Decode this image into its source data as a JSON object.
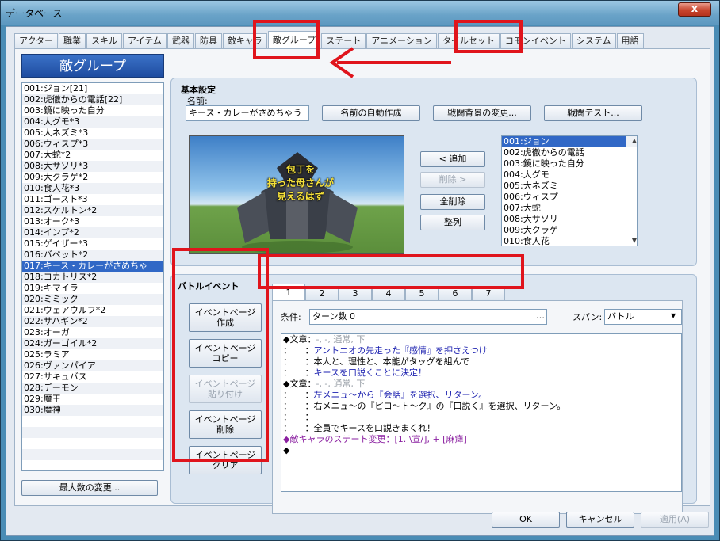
{
  "window": {
    "title": "データベース",
    "close_label": "x"
  },
  "tabs": [
    "アクター",
    "職業",
    "スキル",
    "アイテム",
    "武器",
    "防具",
    "敵キャラ",
    "敵グループ",
    "ステート",
    "アニメーション",
    "タイルセット",
    "コモンイベント",
    "システム",
    "用語"
  ],
  "active_tab_index": 7,
  "list_title": "敵グループ",
  "enemy_groups": [
    "001:ジョン[21]",
    "002:虎徹からの電話[22]",
    "003:鏡に映った自分",
    "004:大グモ*3",
    "005:大ネズミ*3",
    "006:ウィスプ*3",
    "007:大蛇*2",
    "008:大サソリ*3",
    "009:大クラゲ*2",
    "010:食人花*3",
    "011:ゴースト*3",
    "012:スケルトン*2",
    "013:オーク*3",
    "014:インプ*2",
    "015:ゲイザー*3",
    "016:バペット*2",
    "017:キース・カレーがさめちゃ",
    "018:コカトリス*2",
    "019:キマイラ",
    "020:ミミック",
    "021:ウェアウルフ*2",
    "022:サハギン*2",
    "023:オーガ",
    "024:ガーゴイル*2",
    "025:ラミア",
    "026:ヴァンパイア",
    "027:サキュバス",
    "028:デーモン",
    "029:魔王",
    "030:魔神"
  ],
  "selected_group_index": 16,
  "max_button": "最大数の変更...",
  "basic": {
    "section_label": "基本設定",
    "name_label": "名前:",
    "name_value": "キース・カレーがさめちゃう",
    "auto_name_button": "名前の自動作成",
    "change_bg_button": "戦闘背景の変更...",
    "battle_test_button": "戦闘テスト...",
    "preview_caption": "包丁を\n持った母さんが\n見えるはず",
    "add_button": "< 追加",
    "remove_button": "削除 >",
    "clear_button": "全削除",
    "align_button": "整列"
  },
  "members": [
    "001:ジョン",
    "002:虎徹からの電話",
    "003:鏡に映った自分",
    "004:大グモ",
    "005:大ネズミ",
    "006:ウィスプ",
    "007:大蛇",
    "008:大サソリ",
    "009:大クラゲ",
    "010:食人花"
  ],
  "battle": {
    "section_label": "バトルイベント",
    "page_tabs": [
      "1",
      "2",
      "3",
      "4",
      "5",
      "6",
      "7"
    ],
    "copy_page_buttons": [
      "イベントページ\n作成",
      "イベントページ\nコピー",
      "イベントページ\n貼り付け",
      "イベントページ\n削除",
      "イベントページ\nクリア"
    ],
    "condition_label": "条件:",
    "condition_value": "ターン数 0",
    "span_label": "スパン:",
    "span_value": "バトル",
    "commands": [
      {
        "text": "◆文章：",
        "rest": "-, -, 通常, 下",
        "c": "gray"
      },
      {
        "text": "：　　：",
        "rest": "アントニオの先走った『感情』を押さえつけ",
        "c": "blue"
      },
      {
        "text": "：　　：",
        "rest": "本人と、理性と、本能がタッグを組んで",
        "c": ""
      },
      {
        "text": "：　　：",
        "rest": "キースを口説くことに決定！",
        "c": "blue"
      },
      {
        "text": "◆文章：",
        "rest": "-, -, 通常, 下",
        "c": "gray"
      },
      {
        "text": "：　　：",
        "rest": "左メニュ～から『会話』を選択、リターン。",
        "c": "blue"
      },
      {
        "text": "：　　：",
        "rest": "右メニュ～の『ピロ～ト～ク』の『口説く』を選択、リターン。",
        "c": ""
      },
      {
        "text": "：　　：",
        "rest": "",
        "c": ""
      },
      {
        "text": "：　　：",
        "rest": "全員でキースを口説きまくれ！",
        "c": ""
      },
      {
        "text": "◆敵キャラのステート変更：",
        "rest": "[1. \\宣/], + [麻痺]",
        "c": "purple"
      },
      {
        "text": "◆",
        "rest": "",
        "c": ""
      }
    ]
  },
  "footer": {
    "ok": "OK",
    "cancel": "キャンセル",
    "apply": "適用(A)"
  },
  "accent_color": "#e0141c"
}
